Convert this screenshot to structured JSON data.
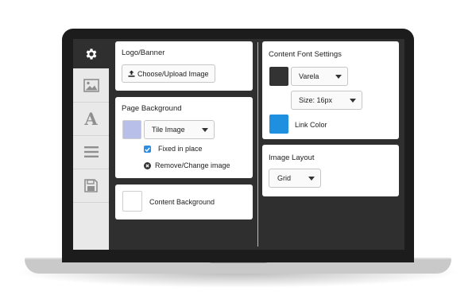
{
  "sidebar": {
    "items": [
      {
        "icon": "gear-icon",
        "active": true
      },
      {
        "icon": "image-icon",
        "active": false
      },
      {
        "icon": "font-icon",
        "glyph": "A",
        "active": false
      },
      {
        "icon": "menu-icon",
        "active": false
      },
      {
        "icon": "save-icon",
        "active": false
      }
    ]
  },
  "logo_banner": {
    "title": "Logo/Banner",
    "upload_button": "Choose/Upload Image"
  },
  "page_background": {
    "title": "Page Background",
    "swatch_color": "#b8bfe8",
    "mode_select": "Tile Image",
    "fixed_label": "Fixed in place",
    "remove_label": "Remove/Change image"
  },
  "content_background": {
    "label": "Content Background",
    "swatch_color": "#ffffff"
  },
  "content_font": {
    "title": "Content Font Settings",
    "font_swatch_color": "#333333",
    "font_select": "Varela",
    "size_select": "Size: 16px",
    "link_swatch_color": "#1f8fe0",
    "link_label": "Link Color"
  },
  "image_layout": {
    "title": "Image Layout",
    "layout_select": "Grid"
  },
  "colors": {
    "accent": "#2d8ee0",
    "screen_bg": "#2f2f2f",
    "sidebar_bg": "#e9e9e9"
  }
}
